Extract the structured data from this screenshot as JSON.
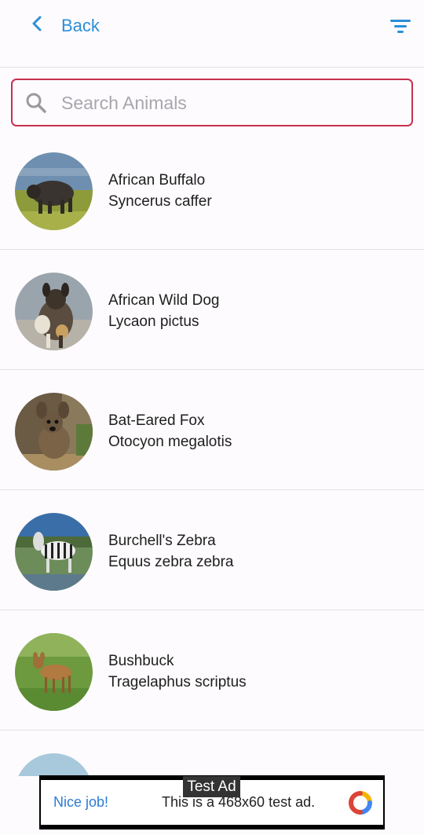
{
  "header": {
    "back_label": "Back",
    "accent": "#2b8fd8"
  },
  "search": {
    "placeholder": "Search Animals",
    "value": "",
    "border_color": "#c8304f"
  },
  "animals": [
    {
      "name": "African Buffalo",
      "scientific": "Syncerus caffer"
    },
    {
      "name": "African Wild Dog",
      "scientific": "Lycaon pictus"
    },
    {
      "name": "Bat-Eared Fox",
      "scientific": "Otocyon megalotis"
    },
    {
      "name": "Burchell's Zebra",
      "scientific": "Equus zebra zebra"
    },
    {
      "name": "Bushbuck",
      "scientific": "Tragelaphus scriptus"
    }
  ],
  "ad": {
    "tag": "Test Ad",
    "nice": "Nice job!",
    "text": "This is a 468x60 test ad."
  },
  "icons": {
    "back": "chevron-left-icon",
    "filter": "filter-icon",
    "search": "search-icon",
    "ad_logo": "ad-logo-icon"
  }
}
